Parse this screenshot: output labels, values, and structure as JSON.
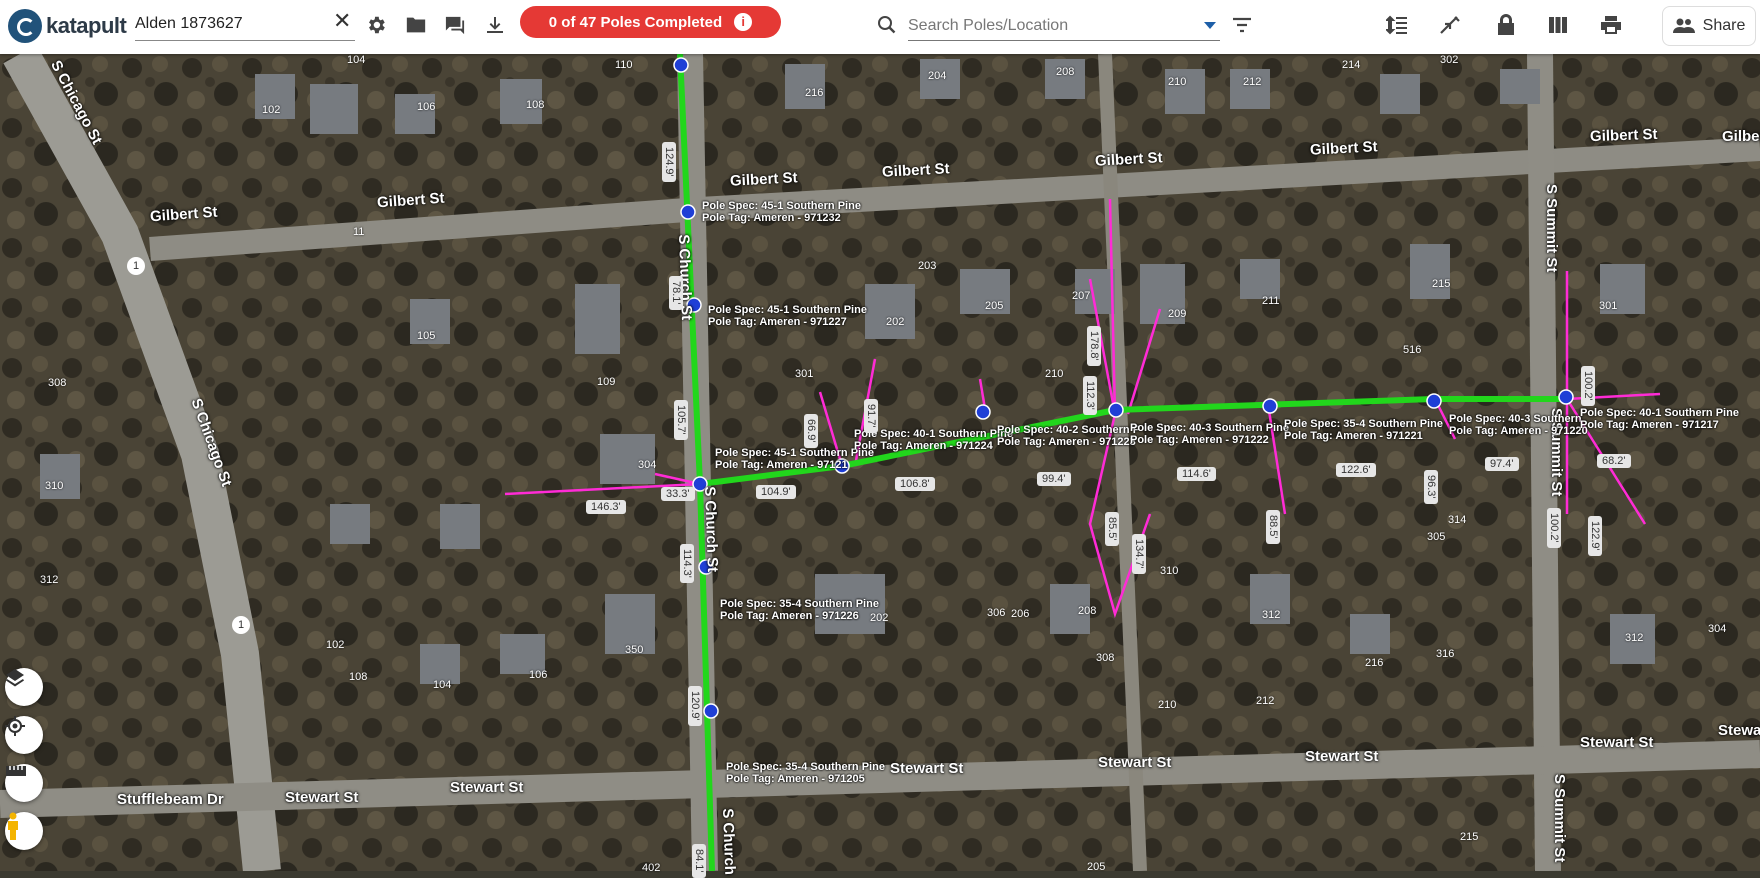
{
  "app": {
    "logo_text": "katapult"
  },
  "header": {
    "job_name": "Alden 1873627",
    "progress_label": "0 of 47 Poles Completed",
    "search_placeholder": "Search Poles/Location",
    "share_label": "Share"
  },
  "streets": [
    "S Chicago St",
    "S Chicago St",
    "Gilbert St",
    "Gilbert St",
    "Gilbert St",
    "Gilbert St",
    "Gilbert St",
    "Gilbert St",
    "Gilbert St",
    "Gilbert St",
    "S Church St",
    "S Church St",
    "S Church",
    "S Summit St",
    "S Summit St",
    "S Summit St",
    "Stewart St",
    "Stewart St",
    "Stewart St",
    "Stewart St",
    "Stewart St",
    "Stewart St",
    "Stewart",
    "Stufflebeam Dr"
  ],
  "route_badges": [
    "1",
    "1"
  ],
  "addresses": [
    "104",
    "110",
    "102",
    "106",
    "108",
    "216",
    "204",
    "208",
    "210",
    "212",
    "214",
    "302",
    "11",
    "203",
    "205",
    "207",
    "209",
    "211",
    "215",
    "301",
    "202",
    "105",
    "308",
    "301",
    "109",
    "210",
    "516",
    "301",
    "310",
    "304",
    "312",
    "102",
    "108",
    "104",
    "106",
    "350",
    "202",
    "306",
    "206",
    "208",
    "310",
    "312",
    "216",
    "316",
    "304",
    "312",
    "314",
    "305",
    "402",
    "210",
    "212",
    "205",
    "215",
    "308"
  ],
  "poles": [
    {
      "spec": "Pole Spec: 45-1 Southern Pine",
      "tag": "Pole Tag: Ameren - 971232"
    },
    {
      "spec": "Pole Spec: 45-1 Southern Pine",
      "tag": "Pole Tag: Ameren - 971227"
    },
    {
      "spec": "Pole Spec: 45-1 Southern Pine",
      "tag": "Pole Tag: Ameren - 97121"
    },
    {
      "spec": "Pole Spec: 40-1 Southern Pine",
      "tag": "Pole Tag: Ameren - 971224"
    },
    {
      "spec": "Pole Spec: 40-2 Southern P",
      "tag": "Pole Tag: Ameren - 971223"
    },
    {
      "spec": "Pole Spec: 40-3 Southern Pine",
      "tag": "Pole Tag: Ameren - 971222"
    },
    {
      "spec": "Pole Spec: 35-4 Southern Pine",
      "tag": "Pole Tag: Ameren - 971221"
    },
    {
      "spec": "Pole Spec: 40-3 Southern",
      "tag": "Pole Tag: Ameren - 971220"
    },
    {
      "spec": "Pole Spec: 40-1 Southern Pine",
      "tag": "Pole Tag: Ameren - 971217"
    },
    {
      "spec": "Pole Spec: 35-4 Southern Pine",
      "tag": "Pole Tag: Ameren - 971226"
    },
    {
      "spec": "Pole Spec: 35-4 Southern Pine",
      "tag": "Pole Tag: Ameren - 971205"
    }
  ],
  "spans": [
    "124.9'",
    "78.1'",
    "105.7'",
    "146.3'",
    "33.3'",
    "104.9'",
    "106.8'",
    "99.4'",
    "114.6'",
    "122.6'",
    "97.4'",
    "68.2'",
    "114.3'",
    "120.9'",
    "84.1'",
    "66.9'",
    "91.7'",
    "112.3'",
    "178.8'",
    "85.5'",
    "134.7'",
    "88.5'",
    "96.3'",
    "100.2'",
    "122.9'",
    "100.2'"
  ],
  "colors": {
    "progress": "#e53935",
    "line": "#22d61c",
    "anchor": "#ff2bd6",
    "pole": "#1f3fd6"
  }
}
